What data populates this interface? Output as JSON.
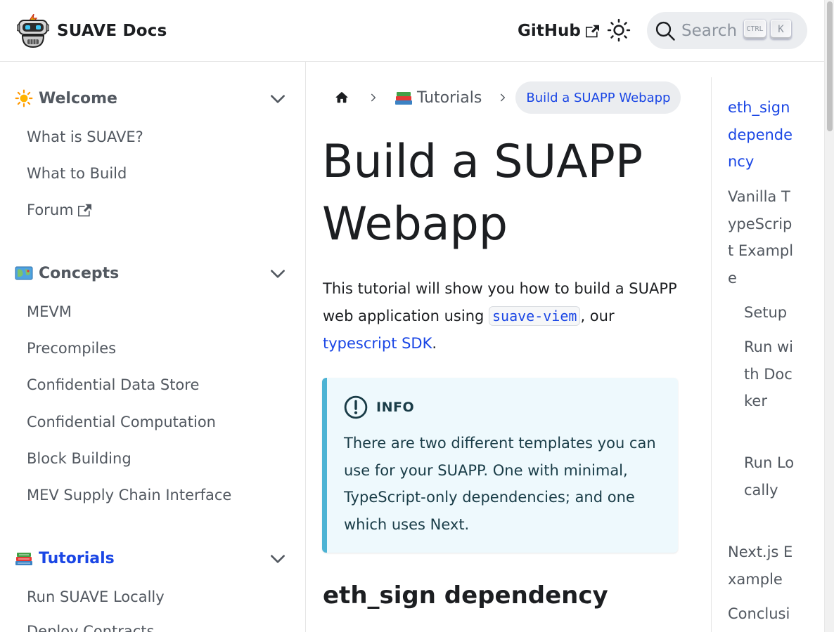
{
  "navbar": {
    "brand_title": "SUAVE Docs",
    "github_label": "GitHub",
    "search_placeholder": "Search",
    "kbd_ctrl": "CTRL",
    "kbd_k": "K"
  },
  "sidebar": {
    "categories": [
      {
        "emoji": "sun",
        "label": "Welcome",
        "active": false,
        "items": [
          "What is SUAVE?",
          "What to Build",
          "Forum"
        ]
      },
      {
        "emoji": "map",
        "label": "Concepts",
        "active": false,
        "items": [
          "MEVM",
          "Precompiles",
          "Confidential Data Store",
          "Confidential Computation",
          "Block Building",
          "MEV Supply Chain Interface"
        ]
      },
      {
        "emoji": "books",
        "label": "Tutorials",
        "active": true,
        "items": [
          "Run SUAVE Locally",
          "Deploy Contracts"
        ]
      }
    ]
  },
  "breadcrumbs": {
    "home_icon": "home-icon",
    "section": "Tutorials",
    "current": "Build a SUAPP Webapp"
  },
  "article": {
    "title": "Build a SUAPP Webapp",
    "intro_text_1": "This tutorial will show you how to build a SUAPP web application using ",
    "intro_code": "suave-viem",
    "intro_text_2": ", our ",
    "intro_link": "typescript SDK",
    "intro_text_3": ".",
    "admonition": {
      "title": "INFO",
      "body": "There are two different templates you can use for your SUAPP. One with minimal, TypeScript-only dependencies; and one which uses Next."
    },
    "h2": "eth_sign dependency"
  },
  "toc": [
    {
      "label": "eth_sign dependency",
      "level": 1,
      "active": true
    },
    {
      "label": "Vanilla TypeScript Example",
      "level": 1,
      "active": false
    },
    {
      "label": "Setup",
      "level": 2,
      "active": false
    },
    {
      "label": "Run with Docker",
      "level": 2,
      "active": false
    },
    {
      "label": "Run Locally",
      "level": 2,
      "active": false
    },
    {
      "label": "Next.js Example",
      "level": 1,
      "active": false
    },
    {
      "label": "Conclusion",
      "level": 1,
      "active": false
    }
  ],
  "colors": {
    "link": "#1a46e5",
    "info_border": "#4cb3d4",
    "info_bg": "#eef9fd"
  }
}
